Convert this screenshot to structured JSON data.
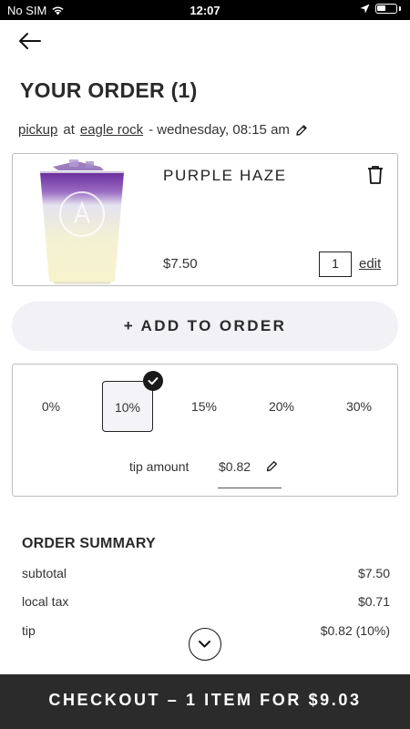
{
  "status_bar": {
    "carrier": "No SIM",
    "time": "12:07"
  },
  "header": {
    "title": "YOUR ORDER (1)"
  },
  "pickup": {
    "mode": "pickup",
    "at": "at",
    "location": "eagle rock",
    "datetime": "- wednesday, 08:15 am"
  },
  "item": {
    "name": "PURPLE HAZE",
    "price": "$7.50",
    "quantity": "1",
    "edit_label": "edit"
  },
  "add_button": {
    "label": "+ ADD TO ORDER"
  },
  "tip": {
    "options": [
      "0%",
      "10%",
      "15%",
      "20%",
      "30%"
    ],
    "selected": "10%",
    "label": "tip amount",
    "amount": "$0.82"
  },
  "summary": {
    "title": "ORDER SUMMARY",
    "rows": [
      {
        "label": "subtotal",
        "value": "$7.50"
      },
      {
        "label": "local tax",
        "value": "$0.71"
      },
      {
        "label": "tip",
        "value": "$0.82 (10%)"
      }
    ]
  },
  "checkout": {
    "label": "CHECKOUT – 1 ITEM FOR $9.03"
  }
}
